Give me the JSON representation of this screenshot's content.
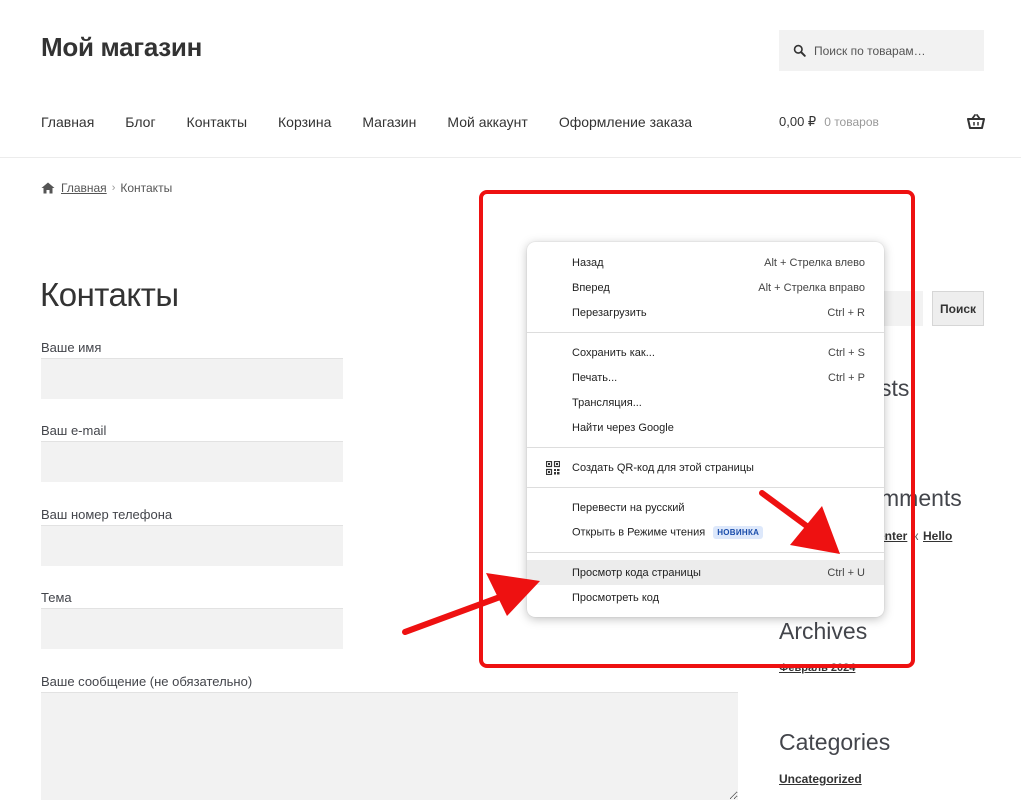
{
  "site": {
    "title": "Мой магазин"
  },
  "search": {
    "placeholder": "Поиск по товарам…"
  },
  "nav": {
    "items": [
      {
        "label": "Главная"
      },
      {
        "label": "Блог"
      },
      {
        "label": "Контакты"
      },
      {
        "label": "Корзина"
      },
      {
        "label": "Магазин"
      },
      {
        "label": "Мой аккаунт"
      },
      {
        "label": "Оформление заказа"
      }
    ]
  },
  "cart": {
    "total": "0,00 ₽",
    "count": "0 товаров"
  },
  "breadcrumb": {
    "home": "Главная",
    "separator": "›",
    "current": "Контакты"
  },
  "page": {
    "title": "Контакты"
  },
  "form": {
    "name_label": "Ваше имя",
    "email_label": "Ваш e-mail",
    "phone_label": "Ваш номер телефона",
    "subject_label": "Тема",
    "message_label": "Ваше сообщение (не обязательно)"
  },
  "sidebar": {
    "search_button": "Поиск",
    "recent_posts_fragment": "sts",
    "recent_comments_fragment": "mments",
    "comment_author_fragment": "enter",
    "comment_connector": "к",
    "comment_post": "Hello",
    "archives_title": "Archives",
    "archive_item": "Февраль 2024",
    "categories_title": "Categories",
    "category_item": "Uncategorized"
  },
  "context_menu": {
    "groups": [
      [
        {
          "label": "Назад",
          "shortcut": "Alt + Стрелка влево"
        },
        {
          "label": "Вперед",
          "shortcut": "Alt + Стрелка вправо"
        },
        {
          "label": "Перезагрузить",
          "shortcut": "Ctrl + R"
        }
      ],
      [
        {
          "label": "Сохранить как...",
          "shortcut": "Ctrl + S"
        },
        {
          "label": "Печать...",
          "shortcut": "Ctrl + P"
        },
        {
          "label": "Трансляция...",
          "shortcut": ""
        },
        {
          "label": "Найти через Google",
          "shortcut": ""
        }
      ],
      [
        {
          "label": "Создать QR-код для этой страницы",
          "shortcut": "",
          "icon": "qr-code-icon"
        }
      ],
      [
        {
          "label": "Перевести на русский",
          "shortcut": ""
        },
        {
          "label": "Открыть в Режиме чтения",
          "shortcut": "",
          "badge": "НОВИНКА"
        }
      ],
      [
        {
          "label": "Просмотр кода страницы",
          "shortcut": "Ctrl + U",
          "highlighted": true
        },
        {
          "label": "Просмотреть код",
          "shortcut": ""
        }
      ]
    ]
  },
  "colors": {
    "annotation": "#ee1111",
    "field_bg": "#f2f2f2",
    "badge_bg": "#dde8fb",
    "badge_text": "#1a4dab"
  }
}
